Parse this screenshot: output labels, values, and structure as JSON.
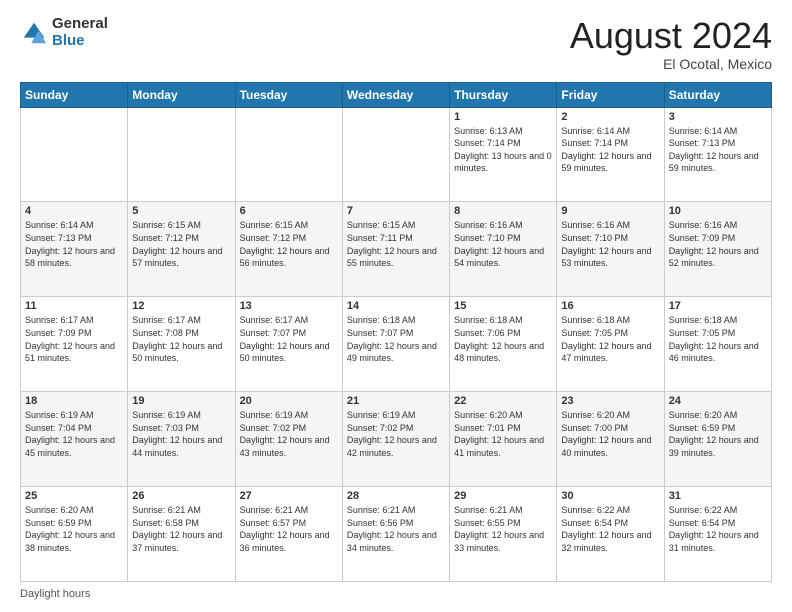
{
  "logo": {
    "general": "General",
    "blue": "Blue"
  },
  "title": "August 2024",
  "location": "El Ocotal, Mexico",
  "days": [
    "Sunday",
    "Monday",
    "Tuesday",
    "Wednesday",
    "Thursday",
    "Friday",
    "Saturday"
  ],
  "weeks": [
    [
      {
        "day": "",
        "content": ""
      },
      {
        "day": "",
        "content": ""
      },
      {
        "day": "",
        "content": ""
      },
      {
        "day": "",
        "content": ""
      },
      {
        "day": "1",
        "content": "Sunrise: 6:13 AM\nSunset: 7:14 PM\nDaylight: 13 hours\nand 0 minutes."
      },
      {
        "day": "2",
        "content": "Sunrise: 6:14 AM\nSunset: 7:14 PM\nDaylight: 12 hours\nand 59 minutes."
      },
      {
        "day": "3",
        "content": "Sunrise: 6:14 AM\nSunset: 7:13 PM\nDaylight: 12 hours\nand 59 minutes."
      }
    ],
    [
      {
        "day": "4",
        "content": "Sunrise: 6:14 AM\nSunset: 7:13 PM\nDaylight: 12 hours\nand 58 minutes."
      },
      {
        "day": "5",
        "content": "Sunrise: 6:15 AM\nSunset: 7:12 PM\nDaylight: 12 hours\nand 57 minutes."
      },
      {
        "day": "6",
        "content": "Sunrise: 6:15 AM\nSunset: 7:12 PM\nDaylight: 12 hours\nand 56 minutes."
      },
      {
        "day": "7",
        "content": "Sunrise: 6:15 AM\nSunset: 7:11 PM\nDaylight: 12 hours\nand 55 minutes."
      },
      {
        "day": "8",
        "content": "Sunrise: 6:16 AM\nSunset: 7:10 PM\nDaylight: 12 hours\nand 54 minutes."
      },
      {
        "day": "9",
        "content": "Sunrise: 6:16 AM\nSunset: 7:10 PM\nDaylight: 12 hours\nand 53 minutes."
      },
      {
        "day": "10",
        "content": "Sunrise: 6:16 AM\nSunset: 7:09 PM\nDaylight: 12 hours\nand 52 minutes."
      }
    ],
    [
      {
        "day": "11",
        "content": "Sunrise: 6:17 AM\nSunset: 7:09 PM\nDaylight: 12 hours\nand 51 minutes."
      },
      {
        "day": "12",
        "content": "Sunrise: 6:17 AM\nSunset: 7:08 PM\nDaylight: 12 hours\nand 50 minutes."
      },
      {
        "day": "13",
        "content": "Sunrise: 6:17 AM\nSunset: 7:07 PM\nDaylight: 12 hours\nand 50 minutes."
      },
      {
        "day": "14",
        "content": "Sunrise: 6:18 AM\nSunset: 7:07 PM\nDaylight: 12 hours\nand 49 minutes."
      },
      {
        "day": "15",
        "content": "Sunrise: 6:18 AM\nSunset: 7:06 PM\nDaylight: 12 hours\nand 48 minutes."
      },
      {
        "day": "16",
        "content": "Sunrise: 6:18 AM\nSunset: 7:05 PM\nDaylight: 12 hours\nand 47 minutes."
      },
      {
        "day": "17",
        "content": "Sunrise: 6:18 AM\nSunset: 7:05 PM\nDaylight: 12 hours\nand 46 minutes."
      }
    ],
    [
      {
        "day": "18",
        "content": "Sunrise: 6:19 AM\nSunset: 7:04 PM\nDaylight: 12 hours\nand 45 minutes."
      },
      {
        "day": "19",
        "content": "Sunrise: 6:19 AM\nSunset: 7:03 PM\nDaylight: 12 hours\nand 44 minutes."
      },
      {
        "day": "20",
        "content": "Sunrise: 6:19 AM\nSunset: 7:02 PM\nDaylight: 12 hours\nand 43 minutes."
      },
      {
        "day": "21",
        "content": "Sunrise: 6:19 AM\nSunset: 7:02 PM\nDaylight: 12 hours\nand 42 minutes."
      },
      {
        "day": "22",
        "content": "Sunrise: 6:20 AM\nSunset: 7:01 PM\nDaylight: 12 hours\nand 41 minutes."
      },
      {
        "day": "23",
        "content": "Sunrise: 6:20 AM\nSunset: 7:00 PM\nDaylight: 12 hours\nand 40 minutes."
      },
      {
        "day": "24",
        "content": "Sunrise: 6:20 AM\nSunset: 6:59 PM\nDaylight: 12 hours\nand 39 minutes."
      }
    ],
    [
      {
        "day": "25",
        "content": "Sunrise: 6:20 AM\nSunset: 6:59 PM\nDaylight: 12 hours\nand 38 minutes."
      },
      {
        "day": "26",
        "content": "Sunrise: 6:21 AM\nSunset: 6:58 PM\nDaylight: 12 hours\nand 37 minutes."
      },
      {
        "day": "27",
        "content": "Sunrise: 6:21 AM\nSunset: 6:57 PM\nDaylight: 12 hours\nand 36 minutes."
      },
      {
        "day": "28",
        "content": "Sunrise: 6:21 AM\nSunset: 6:56 PM\nDaylight: 12 hours\nand 34 minutes."
      },
      {
        "day": "29",
        "content": "Sunrise: 6:21 AM\nSunset: 6:55 PM\nDaylight: 12 hours\nand 33 minutes."
      },
      {
        "day": "30",
        "content": "Sunrise: 6:22 AM\nSunset: 6:54 PM\nDaylight: 12 hours\nand 32 minutes."
      },
      {
        "day": "31",
        "content": "Sunrise: 6:22 AM\nSunset: 6:54 PM\nDaylight: 12 hours\nand 31 minutes."
      }
    ]
  ],
  "footer": {
    "daylight_hours": "Daylight hours"
  }
}
